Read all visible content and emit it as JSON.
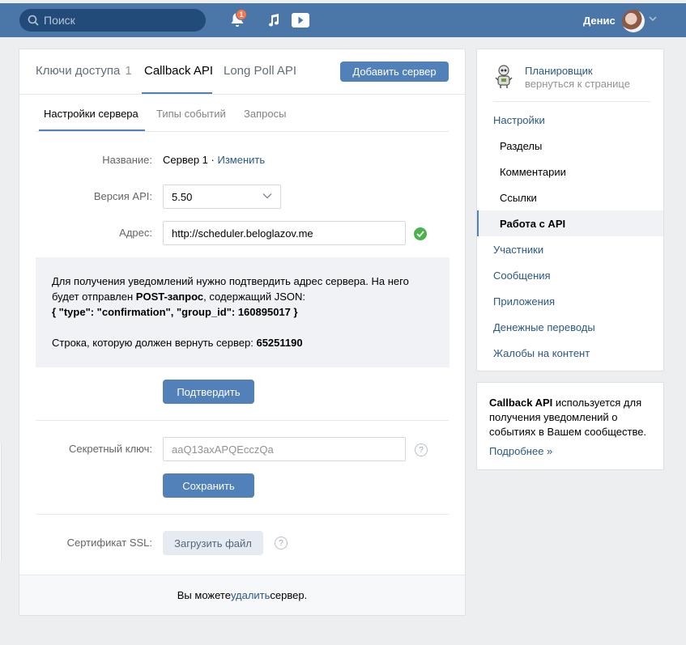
{
  "topbar": {
    "search_placeholder": "Поиск",
    "notification_count": "1",
    "user_name": "Денис"
  },
  "tabs": [
    {
      "label": "Ключи доступа",
      "count": "1"
    },
    {
      "label": "Callback API"
    },
    {
      "label": "Long Poll API"
    }
  ],
  "add_server_label": "Добавить сервер",
  "subtabs": [
    "Настройки сервера",
    "Типы событий",
    "Запросы"
  ],
  "form": {
    "name_label": "Название:",
    "name_value": "Сервер 1",
    "name_sep": " · ",
    "name_change": "Изменить",
    "api_version_label": "Версия API:",
    "api_version_value": "5.50",
    "address_label": "Адрес:",
    "address_value": "http://scheduler.beloglazov.me",
    "secret_label": "Секретный ключ:",
    "secret_placeholder": "aaQ13axAPQEcczQa",
    "save_label": "Сохранить",
    "ssl_label": "Сертификат SSL:",
    "upload_label": "Загрузить файл",
    "help_glyph": "?"
  },
  "info": {
    "line1": "Для получения уведомлений нужно подтвердить адрес сервера. На него будет отправлен ",
    "line1_bold": "POST-запрос",
    "line1_end": ", содержащий JSON:",
    "json": "{ \"type\": \"confirmation\", \"group_id\": 160895017 }",
    "return_text": "Строка, которую должен вернуть сервер: ",
    "return_value": "65251190"
  },
  "confirm_label": "Подтвердить",
  "footer": {
    "before": "Вы можете ",
    "link": "удалить",
    "after": " сервер."
  },
  "sidebar": {
    "group_name": "Планировщик",
    "back_label": "вернуться к странице",
    "items": [
      {
        "label": "Настройки",
        "type": "top"
      },
      {
        "label": "Разделы",
        "type": "sub"
      },
      {
        "label": "Комментарии",
        "type": "sub"
      },
      {
        "label": "Ссылки",
        "type": "sub"
      },
      {
        "label": "Работа с API",
        "type": "active"
      },
      {
        "label": "Участники",
        "type": "top"
      },
      {
        "label": "Сообщения",
        "type": "top"
      },
      {
        "label": "Приложения",
        "type": "top"
      },
      {
        "label": "Денежные переводы",
        "type": "top"
      },
      {
        "label": "Жалобы на контент",
        "type": "top"
      }
    ]
  },
  "help_box": {
    "bold": "Callback API",
    "text": " используется для получения уведомлений о событиях в Вашем сообществе.",
    "link": "Подробнее »"
  },
  "colors": {
    "header": "#4a76a8",
    "accent": "#5181b8",
    "link": "#2a5885",
    "success": "#4bb34b"
  }
}
